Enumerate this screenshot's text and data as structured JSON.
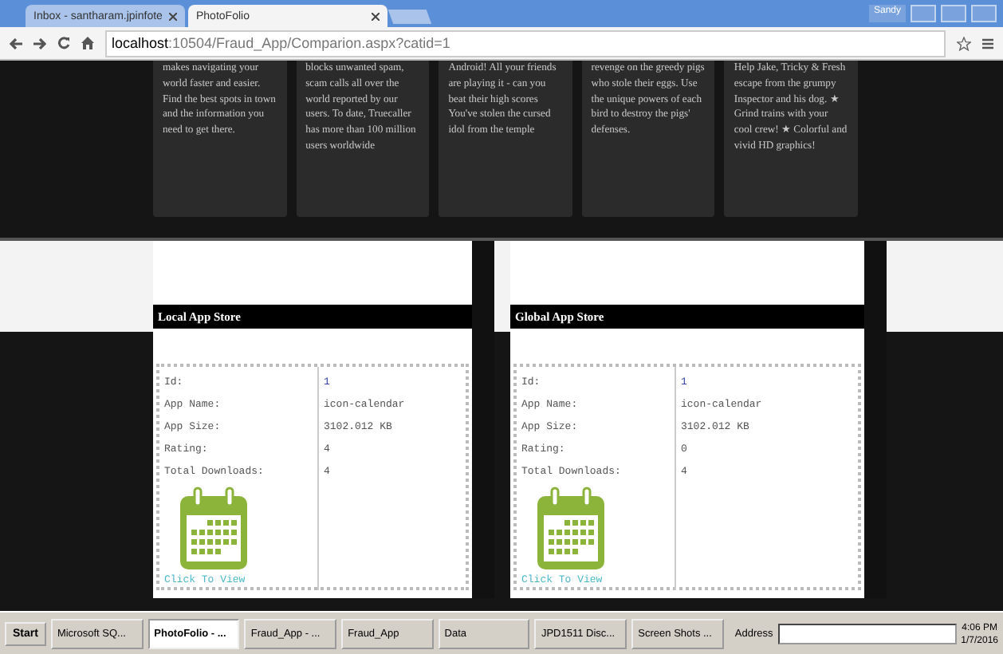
{
  "browser": {
    "tabs": [
      {
        "title": "Inbox - santharam.jpinfote",
        "selected": false
      },
      {
        "title": "PhotoFolio",
        "selected": true
      }
    ],
    "user": "Sandy",
    "url_host": "localhost",
    "url_rest": ":10504/Fraud_App/Comparion.aspx?catid=1"
  },
  "app_cards": [
    {
      "text": "makes navigating your world faster and easier. Find the best spots in town and the information you need to get there."
    },
    {
      "text": "blocks unwanted spam, scam calls all over the world reported by our users. To date, Truecaller has more than 100 million users worldwide"
    },
    {
      "text": "Android! All your friends are playing it - can you beat their high scores You've stolen the cursed idol from the temple"
    },
    {
      "text": "revenge on the greedy pigs who stole their eggs. Use the unique powers of each bird to destroy the pigs' defenses."
    },
    {
      "text": "Help Jake, Tricky & Fresh escape from the grumpy Inspector and his dog. ★ Grind trains with your cool crew! ★ Colorful and vivid HD graphics!"
    }
  ],
  "stores": [
    {
      "title": "Local App Store",
      "rows": [
        {
          "label": "Id:",
          "value": "1"
        },
        {
          "label": "App Name:",
          "value": "icon-calendar"
        },
        {
          "label": "App Size:",
          "value": "3102.012 KB"
        },
        {
          "label": "Rating:",
          "value": "4"
        },
        {
          "label": "Total Downloads:",
          "value": "4"
        }
      ],
      "link": "Click To View"
    },
    {
      "title": "Global App Store",
      "rows": [
        {
          "label": "Id:",
          "value": "1"
        },
        {
          "label": "App Name:",
          "value": "icon-calendar"
        },
        {
          "label": "App Size:",
          "value": "3102.012 KB"
        },
        {
          "label": "Rating:",
          "value": "0"
        },
        {
          "label": "Total Downloads:",
          "value": "4"
        }
      ],
      "link": "Click To View"
    }
  ],
  "taskbar": {
    "start": "Start",
    "items": [
      {
        "label": "Microsoft SQ...",
        "selected": false
      },
      {
        "label": "PhotoFolio - ...",
        "selected": true
      },
      {
        "label": "Fraud_App - ...",
        "selected": false
      },
      {
        "label": "Fraud_App",
        "selected": false
      },
      {
        "label": "Data",
        "selected": false
      },
      {
        "label": "JPD1511 Disc...",
        "selected": false
      },
      {
        "label": "Screen Shots ...",
        "selected": false
      }
    ],
    "address_label": "Address",
    "time": "4:06 PM",
    "date": "1/7/2016"
  }
}
